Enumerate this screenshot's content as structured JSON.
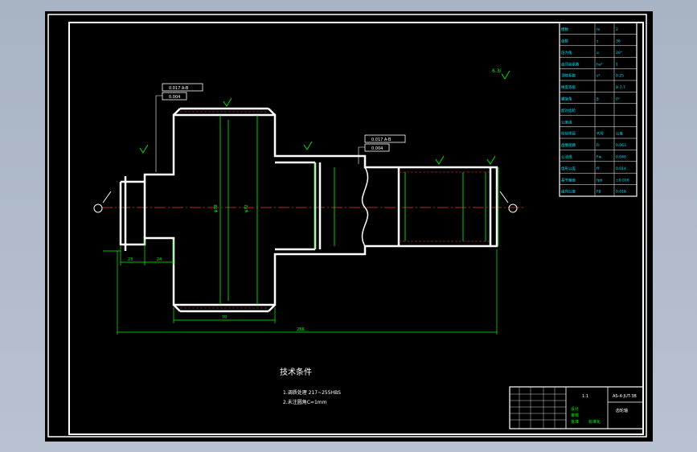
{
  "notes": {
    "heading": "技术条件",
    "items": [
      "1.调质处理 217~255HBS",
      "2.未注圆角C=1mm"
    ]
  },
  "roughness_general": "6.3/",
  "dimensions": {
    "total_length": "286",
    "gear_face": "70",
    "left_step_a": "23",
    "left_step_b": "24",
    "gear_od": "φ78",
    "gear_pd": "φ72"
  },
  "tolerance_frames": [
    {
      "rows": [
        "0.017 A-B",
        "0.004"
      ]
    },
    {
      "rows": [
        "0.017 A-B",
        "0.004"
      ]
    }
  ],
  "title_block": {
    "drawing_no": "AS-4-JUT-3B",
    "part_name": "齿轮轴",
    "scale": "1:1",
    "rows": [
      "设计",
      "审核",
      "批准",
      "标准化"
    ]
  },
  "param_table": {
    "rows": [
      [
        "模数",
        "m",
        "2"
      ],
      [
        "齿数",
        "z",
        "36"
      ],
      [
        "压力角",
        "α",
        "20°"
      ],
      [
        "齿顶高系数",
        "ha*",
        "1"
      ],
      [
        "顶隙系数",
        "c*",
        "0.25"
      ],
      [
        "精度等级",
        "",
        "8-7-7"
      ],
      [
        "螺旋角",
        "β",
        "0°"
      ],
      [
        "配对齿轮",
        "",
        ""
      ],
      [
        "公差组",
        "",
        ""
      ],
      [
        "检验项目",
        "代号",
        "公差"
      ],
      [
        "齿圈径跳",
        "Fr",
        "0.063"
      ],
      [
        "公法线",
        "Fw",
        "0.040"
      ],
      [
        "齿形公差",
        "ff",
        "0.014"
      ],
      [
        "基节偏差",
        "fpb",
        "±0.016"
      ],
      [
        "齿向公差",
        "Fβ",
        "0.016"
      ]
    ]
  },
  "colors": {
    "background": "#000000",
    "outline": "#ffffff",
    "dimension": "#00ff00",
    "centerline": "#ff3030",
    "table": "#00e5ff"
  }
}
